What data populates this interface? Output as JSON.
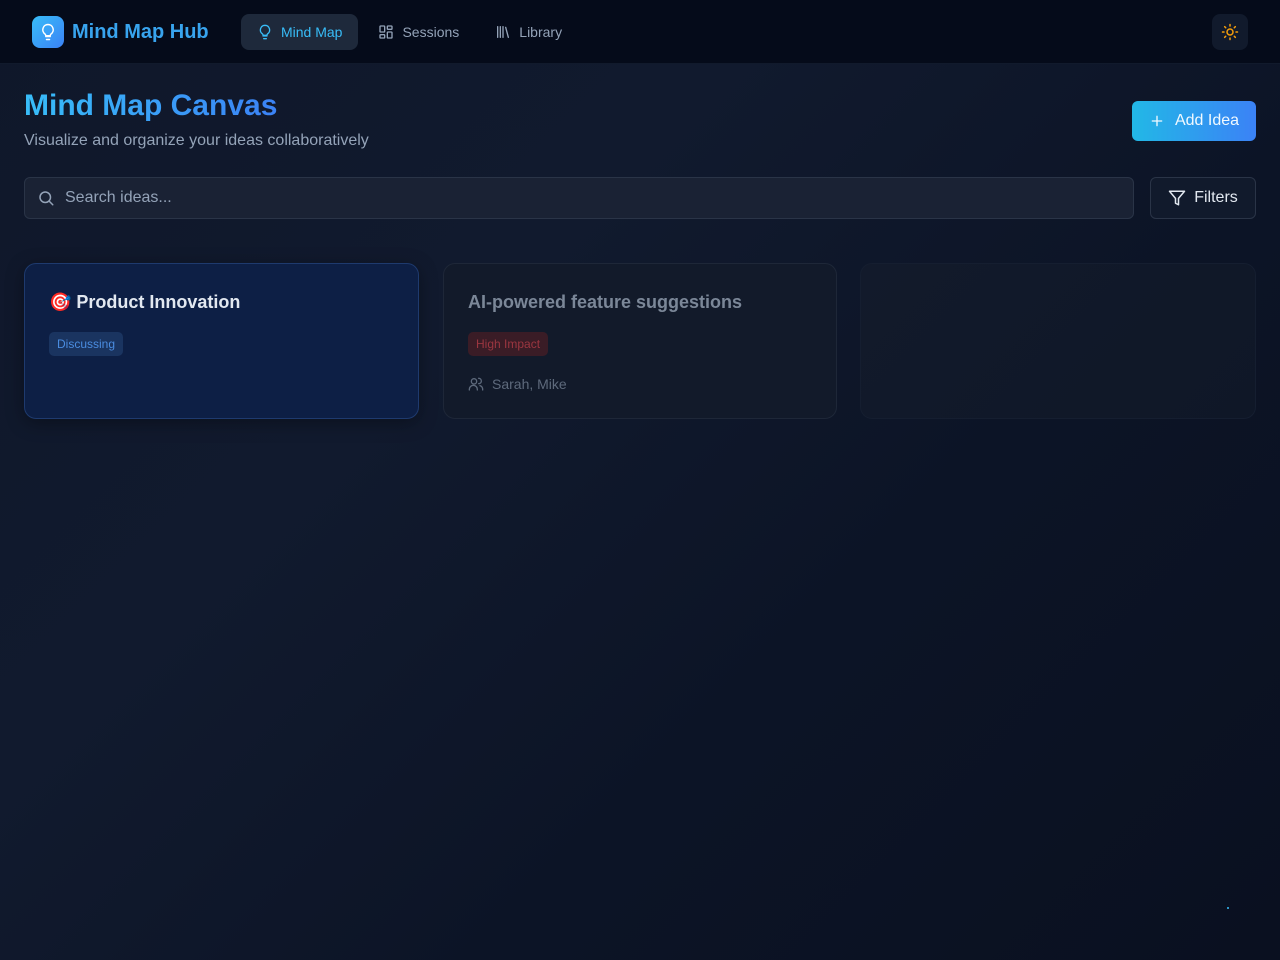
{
  "header": {
    "brand": "Mind Map Hub",
    "nav": [
      {
        "label": "Mind Map",
        "icon": "lightbulb-icon",
        "active": true
      },
      {
        "label": "Sessions",
        "icon": "grid-icon",
        "active": false
      },
      {
        "label": "Library",
        "icon": "library-icon",
        "active": false
      }
    ],
    "theme_icon": "sun-icon"
  },
  "page": {
    "title": "Mind Map Canvas",
    "subtitle": "Visualize and organize your ideas collaboratively",
    "add_label": "Add Idea"
  },
  "search": {
    "placeholder": "Search ideas...",
    "filters_label": "Filters"
  },
  "cards": [
    {
      "title": "🎯 Product Innovation",
      "badge": "Discussing"
    },
    {
      "title": "AI-powered feature suggestions",
      "badge": "High Impact",
      "participants": "Sarah, Mike"
    },
    {}
  ],
  "colors": {
    "accent": "#38bdf8",
    "accent_end": "#3b82f6",
    "background": "#0f172a",
    "discussing": "#4a8ce0",
    "high_impact": "#9b3640"
  }
}
